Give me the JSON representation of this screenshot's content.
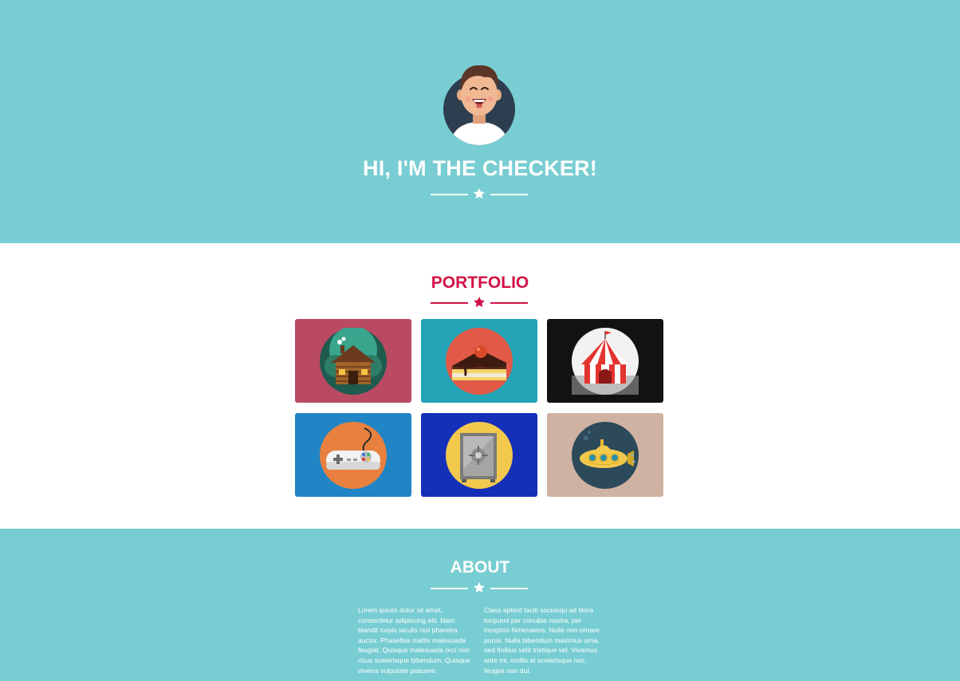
{
  "hero": {
    "title": "HI, I'M THE CHECKER!",
    "background": "#78cdd2",
    "avatar_icon": "smiling-man-avatar-icon"
  },
  "portfolio": {
    "title": "PORTFOLIO",
    "accent": "#d21247",
    "items": [
      {
        "icon": "log-cabin-icon",
        "background": "#b94a62"
      },
      {
        "icon": "cake-slice-icon",
        "background": "#23a4b6"
      },
      {
        "icon": "circus-tent-icon",
        "background": "#141111"
      },
      {
        "icon": "game-controller-icon",
        "background": "#2185c5"
      },
      {
        "icon": "safe-icon",
        "background": "#1430b9"
      },
      {
        "icon": "submarine-icon",
        "background": "#d0b2a3"
      }
    ]
  },
  "about": {
    "title": "ABOUT",
    "paragraphs": [
      "Lorem ipsum dolor sit amet, consectetur adipiscing elit. Nam blandit turpis iaculis nisl pharetra auctor. Phasellus mattis malesuada feugiat. Quisque malesuada orci non risus scelerisque bibendum. Quisque viverra vulputate posuere.",
      "Class aptent taciti sociosqu ad litora torquent per conubia nostra, per inceptos himenaeos. Nulla non ornare purus. Nulla bibendum maximus urna, sed finibus velit tristique vel. Vivamus ante mi, mollis at scelerisque nec, feugiat non dui."
    ]
  }
}
